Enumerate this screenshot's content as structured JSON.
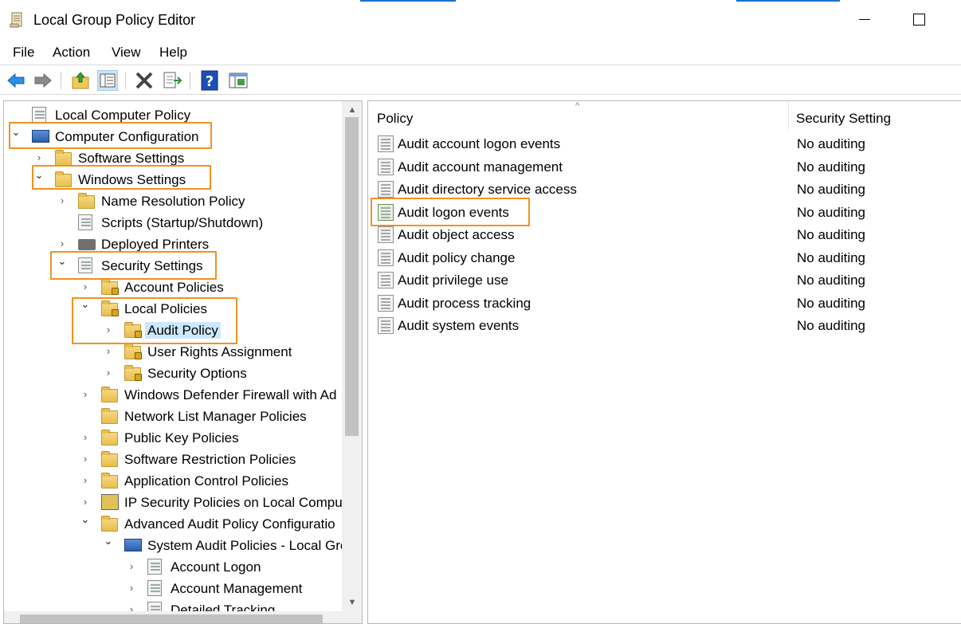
{
  "window": {
    "title": "Local Group Policy Editor",
    "icon": "scroll-icon"
  },
  "menu": {
    "items": [
      "File",
      "Action",
      "View",
      "Help"
    ]
  },
  "toolbar": {
    "buttons": [
      "back-arrow-icon",
      "forward-arrow-icon",
      "up-folder-icon",
      "show-hide-tree-icon",
      "delete-icon",
      "export-list-icon",
      "help-icon",
      "properties-icon"
    ]
  },
  "tree": {
    "rows": [
      {
        "label": "Local Computer Policy",
        "icon": "scroll-icon",
        "state": "none"
      },
      {
        "label": "Computer Configuration",
        "icon": "computer-icon",
        "state": "open"
      },
      {
        "label": "Software Settings",
        "icon": "folder-icon",
        "state": "closed"
      },
      {
        "label": "Windows Settings",
        "icon": "folder-icon",
        "state": "open"
      },
      {
        "label": "Name Resolution Policy",
        "icon": "folder-icon",
        "state": "closed"
      },
      {
        "label": "Scripts (Startup/Shutdown)",
        "icon": "script-icon",
        "state": "none"
      },
      {
        "label": "Deployed Printers",
        "icon": "printer-icon",
        "state": "closed"
      },
      {
        "label": "Security Settings",
        "icon": "security-settings-icon",
        "state": "open"
      },
      {
        "label": "Account Policies",
        "icon": "locked-folder-icon",
        "state": "closed"
      },
      {
        "label": "Local Policies",
        "icon": "locked-folder-icon",
        "state": "open"
      },
      {
        "label": "Audit Policy",
        "icon": "locked-folder-icon",
        "state": "closed",
        "selected": true
      },
      {
        "label": "User Rights Assignment",
        "icon": "locked-folder-icon",
        "state": "closed"
      },
      {
        "label": "Security Options",
        "icon": "locked-folder-icon",
        "state": "closed"
      },
      {
        "label": "Windows Defender Firewall with Ad",
        "icon": "folder-icon",
        "state": "closed"
      },
      {
        "label": "Network List Manager Policies",
        "icon": "folder-icon",
        "state": "none"
      },
      {
        "label": "Public Key Policies",
        "icon": "folder-icon",
        "state": "closed"
      },
      {
        "label": "Software Restriction Policies",
        "icon": "folder-icon",
        "state": "closed"
      },
      {
        "label": "Application Control Policies",
        "icon": "folder-icon",
        "state": "closed"
      },
      {
        "label": "IP Security Policies on Local Comput",
        "icon": "ip-security-icon",
        "state": "closed"
      },
      {
        "label": "Advanced Audit Policy Configuratio",
        "icon": "folder-icon",
        "state": "open"
      },
      {
        "label": "System Audit Policies - Local Gro",
        "icon": "computer-icon",
        "state": "open"
      },
      {
        "label": "Account Logon",
        "icon": "policy-icon",
        "state": "closed"
      },
      {
        "label": "Account Management",
        "icon": "policy-icon",
        "state": "closed"
      },
      {
        "label": "Detailed Tracking",
        "icon": "policy-icon",
        "state": "closed"
      }
    ]
  },
  "list": {
    "columns": [
      "Policy",
      "Security Setting"
    ],
    "rows": [
      {
        "policy": "Audit account logon events",
        "setting": "No auditing"
      },
      {
        "policy": "Audit account management",
        "setting": "No auditing"
      },
      {
        "policy": "Audit directory service access",
        "setting": "No auditing"
      },
      {
        "policy": "Audit logon events",
        "setting": "No auditing",
        "highlighted": true
      },
      {
        "policy": "Audit object access",
        "setting": "No auditing"
      },
      {
        "policy": "Audit policy change",
        "setting": "No auditing"
      },
      {
        "policy": "Audit privilege use",
        "setting": "No auditing"
      },
      {
        "policy": "Audit process tracking",
        "setting": "No auditing"
      },
      {
        "policy": "Audit system events",
        "setting": "No auditing"
      }
    ]
  },
  "colors": {
    "callout": "#f0921e",
    "selection": "#cce8ff",
    "accent": "#1f6fd1"
  }
}
